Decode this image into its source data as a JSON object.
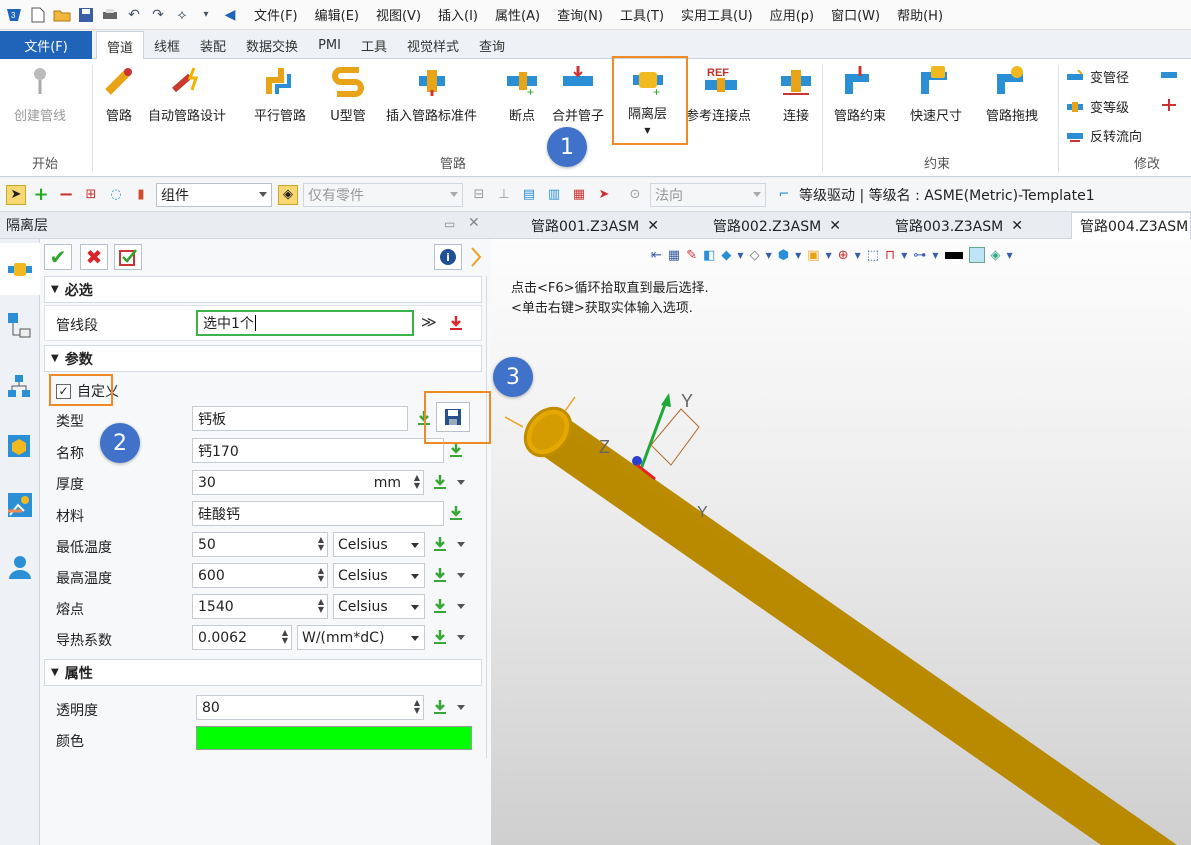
{
  "menubar": {
    "items": [
      "文件(F)",
      "编辑(E)",
      "视图(V)",
      "插入(I)",
      "属性(A)",
      "查询(N)",
      "工具(T)",
      "实用工具(U)",
      "应用(p)",
      "窗口(W)",
      "帮助(H)"
    ]
  },
  "ribbon_tabs": {
    "file": "文件(F)",
    "tabs": [
      "管道",
      "线框",
      "装配",
      "数据交换",
      "PMI",
      "工具",
      "视觉样式",
      "查询"
    ],
    "active": "管道"
  },
  "ribbon": {
    "group_start": {
      "label": "开始",
      "create_pipe": "创建管线"
    },
    "group_pipe": {
      "label": "管路",
      "buttons": [
        "管路",
        "自动管路设计",
        "平行管路",
        "U型管",
        "插入管路标准件",
        "断点",
        "合并管子",
        "隔离层",
        "参考连接点",
        "连接"
      ]
    },
    "group_constraint": {
      "label": "约束",
      "buttons": [
        "管路约束",
        "快速尺寸",
        "管路拖拽"
      ]
    },
    "group_modify": {
      "label": "修改",
      "buttons": [
        "变管径",
        "变等级",
        "反转流向"
      ]
    }
  },
  "toolbar2": {
    "filter_value": "组件",
    "parts_placeholder": "仅有零件",
    "direction": "法向",
    "grade_info": "等级驱动 | 等级名 : ASME(Metric)-Template1"
  },
  "panel": {
    "title": "隔离层",
    "required": {
      "header": "必选",
      "segment_label": "管线段",
      "segment_value": "选中1个"
    },
    "params": {
      "header": "参数",
      "custom_label": "自定义",
      "type_label": "类型",
      "type_value": "钙板",
      "name_label": "名称",
      "name_value": "钙170",
      "thickness_label": "厚度",
      "thickness_value": "30",
      "thickness_unit": "mm",
      "material_label": "材料",
      "material_value": "硅酸钙",
      "min_temp_label": "最低温度",
      "min_temp_value": "50",
      "min_temp_unit": "Celsius",
      "max_temp_label": "最高温度",
      "max_temp_value": "600",
      "max_temp_unit": "Celsius",
      "melt_label": "熔点",
      "melt_value": "1540",
      "melt_unit": "Celsius",
      "conduct_label": "导热系数",
      "conduct_value": "0.0062",
      "conduct_unit": "W/(mm*dC)"
    },
    "props": {
      "header": "属性",
      "transparency_label": "透明度",
      "transparency_value": "80",
      "color_label": "颜色",
      "color_value": "#00ff00"
    }
  },
  "doc_tabs": [
    "管路001.Z3ASM",
    "管路002.Z3ASM",
    "管路003.Z3ASM",
    "管路004.Z3ASM"
  ],
  "viewport": {
    "hint1": "点击<F6>循环拾取直到最后选择.",
    "hint2": "<单击右键>获取实体输入选项.",
    "axis_y": "Y",
    "axis_z": "Z",
    "axis_y2": "Y"
  },
  "callouts": [
    "1",
    "2",
    "3"
  ]
}
